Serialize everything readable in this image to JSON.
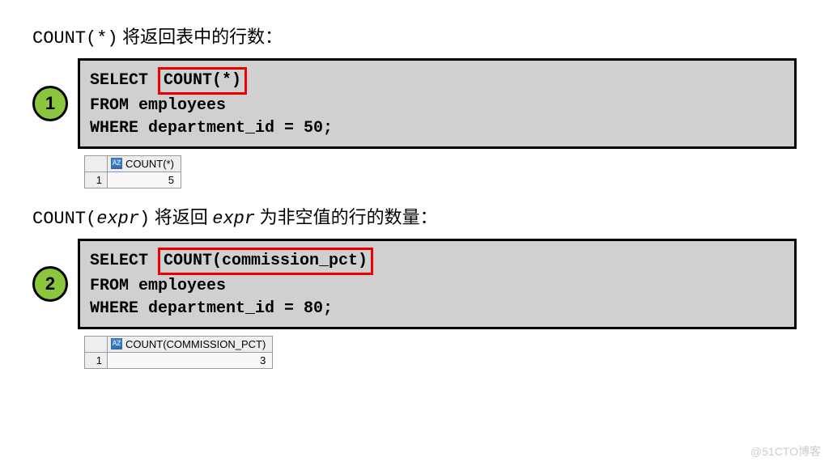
{
  "section1": {
    "desc_prefix": "COUNT(*)",
    "desc_text": " 将返回表中的行数：",
    "badge": "1",
    "sql_select": "SELECT ",
    "sql_count": "COUNT(*)",
    "sql_from": "FROM   employees",
    "sql_where": "WHERE  department_id = 50;",
    "result_header": "COUNT(*)",
    "result_row": "1",
    "result_value": "5"
  },
  "section2": {
    "desc_prefix": "COUNT(",
    "desc_expr": "expr",
    "desc_mid": ") 将返回 ",
    "desc_expr2": "expr",
    "desc_suffix": " 为非空值的行的数量：",
    "badge": "2",
    "sql_select": "SELECT ",
    "sql_count": "COUNT(commission_pct)",
    "sql_from": "FROM   employees",
    "sql_where": "WHERE  department_id = 80;",
    "result_header": "COUNT(COMMISSION_PCT)",
    "result_row": "1",
    "result_value": "3"
  },
  "icon_az": "AZ",
  "watermark": "@51CTO博客"
}
